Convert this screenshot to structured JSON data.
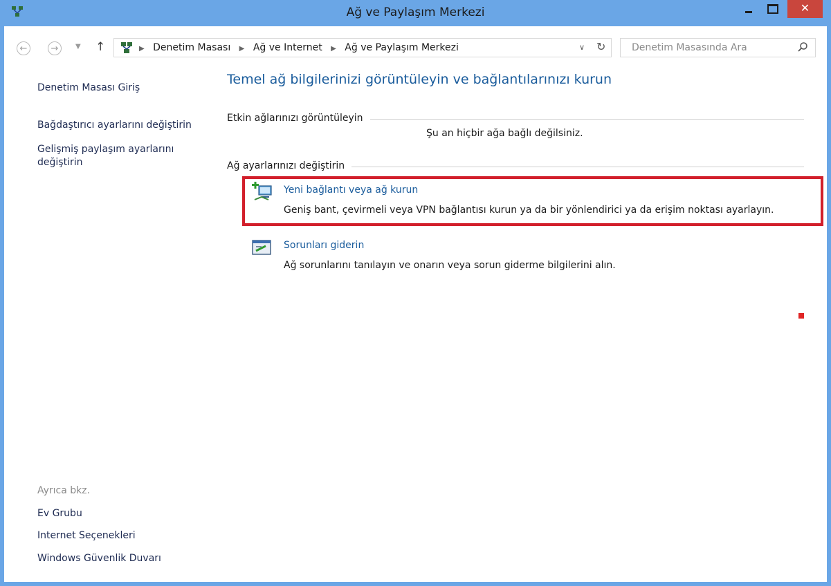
{
  "window": {
    "title": "Ağ ve Paylaşım Merkezi",
    "close_glyph": "✕"
  },
  "address": {
    "breadcrumbs": [
      "Denetim Masası",
      "Ağ ve Internet",
      "Ağ ve Paylaşım Merkezi"
    ],
    "search_placeholder": "Denetim Masasında Ara"
  },
  "sidebar": {
    "home": "Denetim Masası Giriş",
    "adapter": "Bağdaştırıcı ayarlarını değiştirin",
    "sharing": "Gelişmiş paylaşım ayarlarını değiştirin",
    "see_also": "Ayrıca bkz.",
    "links": [
      "Ev Grubu",
      "Internet Seçenekleri",
      "Windows Güvenlik Duvarı"
    ]
  },
  "main": {
    "title": "Temel ağ bilgilerinizi görüntüleyin ve bağlantılarınızı kurun",
    "active_heading": "Etkin ağlarınızı görüntüleyin",
    "active_status": "Şu an hiçbir ağa bağlı değilsiniz.",
    "change_heading": "Ağ ayarlarınızı değiştirin",
    "tasks": [
      {
        "label": "Yeni bağlantı veya ağ kurun",
        "desc": "Geniş bant, çevirmeli veya VPN bağlantısı kurun ya da bir yönlendirici ya da erişim noktası ayarlayın."
      },
      {
        "label": "Sorunları giderin",
        "desc": "Ağ sorunlarını tanılayın ve onarın veya sorun giderme bilgilerini alın."
      }
    ]
  },
  "colors": {
    "titlebar": "#6aa6e6",
    "link": "#1a5c9c",
    "highlight": "#d21f2b"
  }
}
